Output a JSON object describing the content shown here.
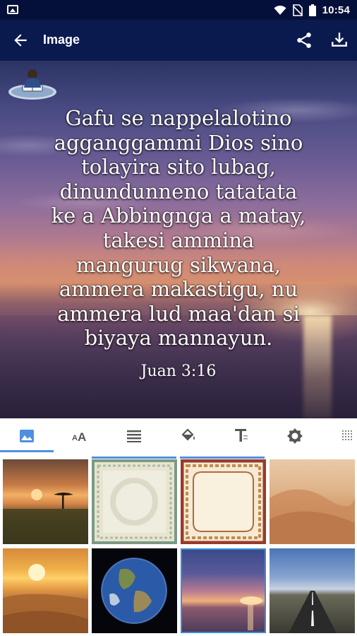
{
  "status_bar": {
    "time": "10:54",
    "icons": [
      "gallery-icon",
      "wifi-icon",
      "no-sim-icon",
      "battery-icon"
    ]
  },
  "app_bar": {
    "title": "Image",
    "icons": [
      "back-arrow-icon",
      "share-icon",
      "download-icon"
    ]
  },
  "verse": {
    "lines": [
      "Gafu se nappelalotino",
      "agganggammi Dios sino",
      "tolayira sito lubag,",
      "dinundunneno tatatata",
      "ke a Abbingnga a matay,",
      "takesi ammina",
      "mangurug sikwana,",
      "ammera makastigu, nu",
      "ammera lud maa'dan si",
      "biyaya mannayun."
    ],
    "reference": "Juan 3:16",
    "text_color": "#ffffff"
  },
  "tools": {
    "tabs": [
      {
        "name": "background-image",
        "icon": "image-icon",
        "selected": true
      },
      {
        "name": "font",
        "icon": "font-size-icon",
        "selected": false
      },
      {
        "name": "alignment",
        "icon": "align-justify-icon",
        "selected": false
      },
      {
        "name": "color",
        "icon": "paint-bucket-icon",
        "selected": false
      },
      {
        "name": "text-style",
        "icon": "text-format-icon",
        "selected": false
      },
      {
        "name": "brightness",
        "icon": "brightness-icon",
        "selected": false
      },
      {
        "name": "texture",
        "icon": "grid-dots-icon",
        "selected": false
      }
    ],
    "accent_color": "#4f8fe0"
  },
  "backgrounds": [
    {
      "name": "savanna-sunset",
      "selected": false
    },
    {
      "name": "floral-frame-green",
      "selected": false
    },
    {
      "name": "ornate-frame-red",
      "selected": false
    },
    {
      "name": "desert-dunes",
      "selected": false
    },
    {
      "name": "desert-sunset",
      "selected": false
    },
    {
      "name": "earth-globe",
      "selected": false
    },
    {
      "name": "sea-sunset",
      "selected": true
    },
    {
      "name": "open-road",
      "selected": false
    }
  ],
  "colors": {
    "status_bar": "#05103a",
    "app_bar": "#0a1a4e"
  }
}
